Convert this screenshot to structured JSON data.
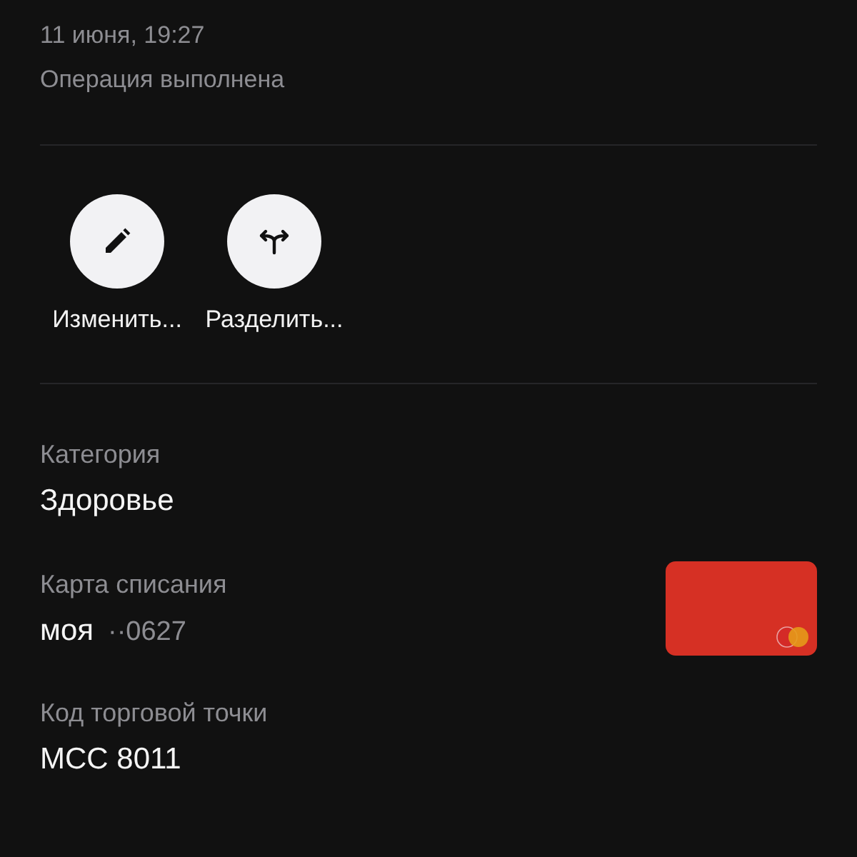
{
  "header": {
    "date": "11 июня, 19:27",
    "status": "Операция выполнена"
  },
  "actions": [
    {
      "kind": "edit",
      "label": "Изменить..."
    },
    {
      "kind": "split",
      "label": "Разделить..."
    }
  ],
  "fields": [
    {
      "kind": "text",
      "label": "Категория",
      "value": "Здоровье"
    },
    {
      "kind": "card",
      "label": "Карта списания",
      "value": "моя",
      "suffix": "··0627",
      "color": "#d63024"
    },
    {
      "kind": "text",
      "label": "Код торговой точки",
      "value": "MCC 8011"
    }
  ]
}
